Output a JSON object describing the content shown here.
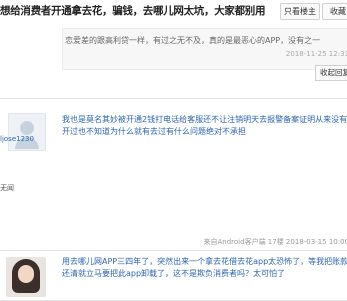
{
  "header": {
    "title": "想给消费者开通拿去花，骗钱，去哪儿网太坑，大家都别用",
    "btn_only_op": "只看楼主",
    "btn_fav": "收藏"
  },
  "post1": {
    "quote_text": "恋爱差的跟高利贷一样，有过之无不及，真的是最恶心的APP，没有之一",
    "quote_time": "2018-11-25 12:33",
    "reply_label": "收起回复"
  },
  "post2": {
    "username": "ljose1230",
    "user_tag": "无闻",
    "content": "我也是莫名其妙被开通2钱打电话给客服还不让注销明天去报警备案证明从来没有开过也不知道为什么就有去过有什么问题绝对不承担",
    "meta": "来自Android客户端  17楼  2018-03-15 10:00"
  },
  "post3": {
    "content": "用去哪儿网APP三四年了，突然出来一个拿去花借去花app太恐怖了，等我把账款还清就立马要把此app卸载了，这不是欺负消费者吗？太可怕了"
  }
}
